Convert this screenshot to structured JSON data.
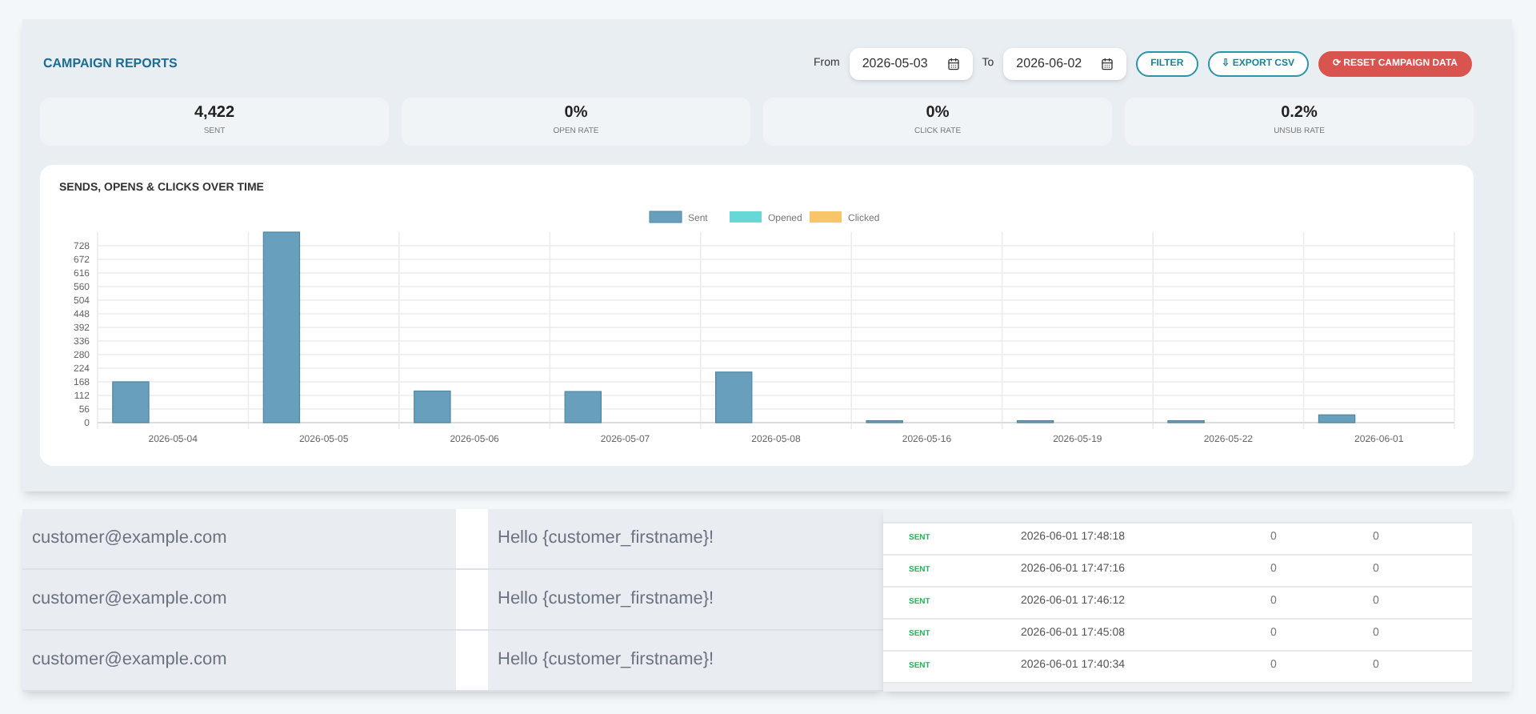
{
  "header": {
    "title": "CAMPAIGN REPORTS",
    "from_label": "From",
    "from_value": "2026-05-03",
    "to_label": "To",
    "to_value": "2026-06-02",
    "buttons": [
      {
        "kind": "outline",
        "label": "FILTER"
      },
      {
        "kind": "outline",
        "label": "⇩ EXPORT CSV"
      },
      {
        "kind": "danger",
        "label": "⟳ RESET CAMPAIGN DATA"
      }
    ]
  },
  "stats": [
    {
      "value": "4,422",
      "label": "SENT"
    },
    {
      "value": "0%",
      "label": "OPEN RATE"
    },
    {
      "value": "0%",
      "label": "CLICK RATE"
    },
    {
      "value": "0.2%",
      "label": "UNSUB RATE"
    }
  ],
  "chart": {
    "title": "SENDS, OPENS & CLICKS OVER TIME",
    "chart_data": {
      "type": "bar",
      "categories": [
        "2026-05-04",
        "2026-05-05",
        "2026-05-06",
        "2026-05-07",
        "2026-05-08",
        "2026-05-16",
        "2026-05-19",
        "2026-05-22",
        "2026-06-01"
      ],
      "series": [
        {
          "name": "Sent",
          "color": "#689fbc",
          "values": [
            168,
            784,
            130,
            128,
            208,
            8,
            8,
            8,
            32
          ]
        },
        {
          "name": "Opened",
          "color": "#68d8d6",
          "values": [
            0,
            0,
            0,
            0,
            0,
            0,
            0,
            0,
            0
          ]
        },
        {
          "name": "Clicked",
          "color": "#f9c56b",
          "values": [
            0,
            0,
            0,
            0,
            0,
            0,
            0,
            0,
            0
          ]
        }
      ],
      "grid": true,
      "ylim": [
        0,
        784
      ],
      "yticks": [
        0,
        56,
        112,
        168,
        224,
        280,
        336,
        392,
        448,
        504,
        560,
        616,
        672,
        728
      ]
    }
  },
  "messages": [
    {
      "recipient": "customer@example.com",
      "subject": "Hello {customer_firstname}!"
    },
    {
      "recipient": "customer@example.com",
      "subject": "Hello {customer_firstname}!"
    },
    {
      "recipient": "customer@example.com",
      "subject": "Hello {customer_firstname}!"
    }
  ],
  "log": [
    {
      "status": "SENT",
      "sent_at": "2026-06-01 17:48:18",
      "column_3": "0",
      "column_4": "0"
    },
    {
      "status": "SENT",
      "sent_at": "2026-06-01 17:47:16",
      "column_3": "0",
      "column_4": "0"
    },
    {
      "status": "SENT",
      "sent_at": "2026-06-01 17:46:12",
      "column_3": "0",
      "column_4": "0"
    },
    {
      "status": "SENT",
      "sent_at": "2026-06-01 17:45:08",
      "column_3": "0",
      "column_4": "0"
    },
    {
      "status": "SENT",
      "sent_at": "2026-06-01 17:40:34",
      "column_3": "0",
      "column_4": "0"
    }
  ]
}
